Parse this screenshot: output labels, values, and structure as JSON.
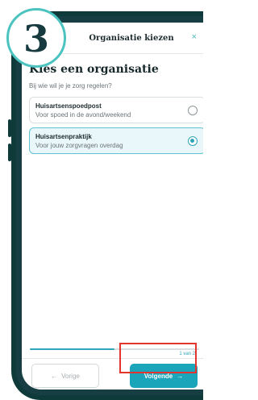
{
  "step_badge": "3",
  "header": {
    "title": "Organisatie kiezen",
    "close_icon": "close-icon",
    "close_glyph": "×"
  },
  "heading": "Kies een organisatie",
  "subheading": "Bij wie wil je je zorg regelen?",
  "options": [
    {
      "title": "Huisartsenspoedpost",
      "subtitle": "Voor spoed in de avond/weekend",
      "selected": false
    },
    {
      "title": "Huisartsenpraktijk",
      "subtitle": "Voor jouw zorgvragen overdag",
      "selected": true
    }
  ],
  "progress": {
    "label": "1 van 2",
    "fraction": 0.5
  },
  "buttons": {
    "previous": {
      "label": "Vorige",
      "icon": "arrow-left-icon",
      "glyph": "←"
    },
    "next": {
      "label": "Volgende",
      "icon": "arrow-right-icon",
      "glyph": "→"
    }
  },
  "colors": {
    "accent": "#1aa5bb",
    "highlight": "#e3342f",
    "badge_border": "#4bc3c0"
  }
}
